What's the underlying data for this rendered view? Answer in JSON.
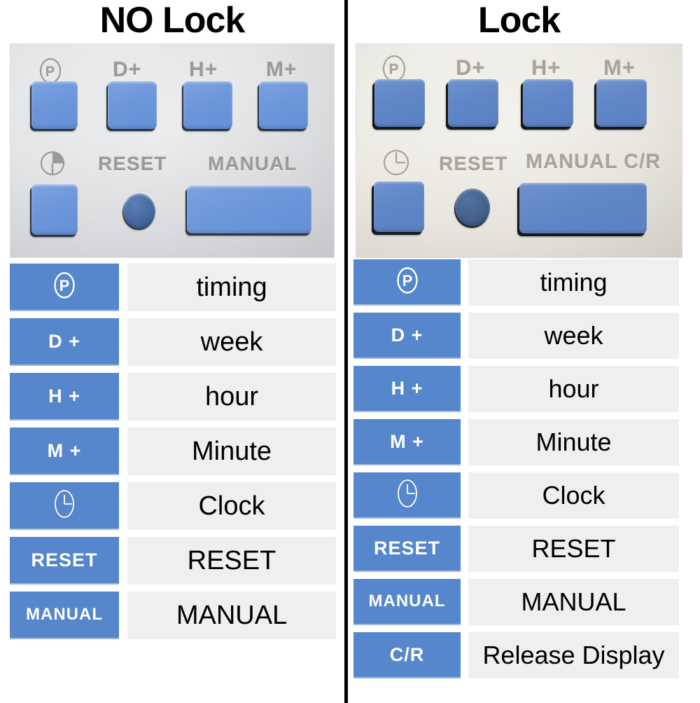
{
  "panels": [
    {
      "id": "no-lock",
      "title": "NO Lock",
      "device": {
        "top_labels": [
          "P",
          "D+",
          "H+",
          "M+"
        ],
        "bottom_labels": [
          "clock-icon",
          "RESET",
          "MANUAL"
        ],
        "manual_label": "MANUAL"
      },
      "legend": [
        {
          "key": "P",
          "key_icon": "p-circle-icon",
          "desc": "timing"
        },
        {
          "key": "D +",
          "key_icon": null,
          "desc": "week"
        },
        {
          "key": "H +",
          "key_icon": null,
          "desc": "hour"
        },
        {
          "key": "M +",
          "key_icon": null,
          "desc": "Minute"
        },
        {
          "key": "",
          "key_icon": "clock-oval-icon",
          "desc": "Clock"
        },
        {
          "key": "RESET",
          "key_icon": null,
          "desc": "RESET"
        },
        {
          "key": "MANUAL",
          "key_icon": null,
          "desc": "MANUAL"
        }
      ]
    },
    {
      "id": "lock",
      "title": "Lock",
      "device": {
        "top_labels": [
          "P",
          "D+",
          "H+",
          "M+"
        ],
        "bottom_labels": [
          "clock-icon",
          "RESET",
          "MANUAL C/R"
        ],
        "manual_label": "MANUAL C/R"
      },
      "legend": [
        {
          "key": "P",
          "key_icon": "p-circle-icon",
          "desc": "timing"
        },
        {
          "key": "D +",
          "key_icon": null,
          "desc": "week"
        },
        {
          "key": "H +",
          "key_icon": null,
          "desc": "hour"
        },
        {
          "key": "M +",
          "key_icon": null,
          "desc": "Minute"
        },
        {
          "key": "",
          "key_icon": "clock-oval-icon",
          "desc": "Clock"
        },
        {
          "key": "RESET",
          "key_icon": null,
          "desc": "RESET"
        },
        {
          "key": "MANUAL",
          "key_icon": null,
          "desc": "MANUAL"
        },
        {
          "key": "C/R",
          "key_icon": null,
          "desc": "Release Display"
        }
      ]
    }
  ],
  "colors": {
    "key_blue": "#5686CC",
    "desc_gray": "#EFEFEF",
    "divider": "#000000",
    "text": "#000000",
    "key_text": "#FFFFFF"
  }
}
